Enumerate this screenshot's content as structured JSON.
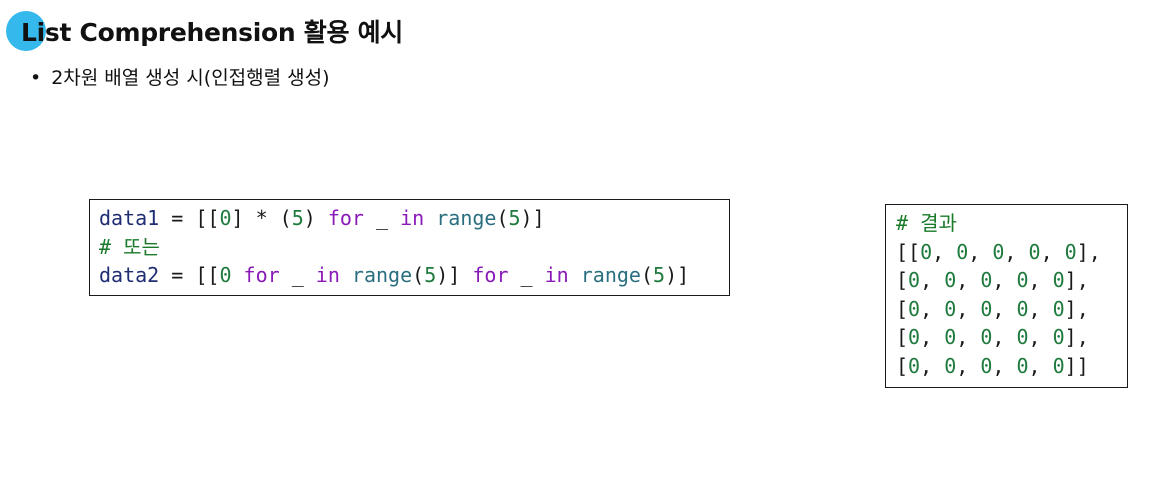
{
  "slide": {
    "title": "List Comprehension 활용 예시",
    "bullet": "•",
    "subtitle": "2차원 배열 생성 시(인접행렬 생성)"
  },
  "code_left": {
    "line1": {
      "var": "data1",
      "p1": " = [[",
      "n1": "0",
      "p2": "] * (",
      "n2": "5",
      "p3": ") ",
      "kw1": "for",
      "p4": " _ ",
      "kw2": "in",
      "p5": " ",
      "fn": "range",
      "p6": "(",
      "n3": "5",
      "p7": ")]"
    },
    "line2": "# 또는",
    "line3": {
      "var": "data2",
      "p1": " = [[",
      "n1": "0",
      "p2": " ",
      "kw1": "for",
      "p3": " _ ",
      "kw2": "in",
      "p4": " ",
      "fn1": "range",
      "p5": "(",
      "n2": "5",
      "p6": ")] ",
      "kw3": "for",
      "p7": " _ ",
      "kw4": "in",
      "p8": " ",
      "fn2": "range",
      "p9": "(",
      "n3": "5",
      "p10": ")]"
    }
  },
  "code_right": {
    "comment": "# 결과",
    "rows": [
      {
        "open": "[[",
        "close": "],"
      },
      {
        "open": "[",
        "close": "],"
      },
      {
        "open": "[",
        "close": "],"
      },
      {
        "open": "[",
        "close": "],"
      },
      {
        "open": "[",
        "close": "]]"
      }
    ],
    "zero": "0",
    "sep": ", "
  },
  "colors": {
    "accent_dot": "#35b9ec",
    "keyword": "#8a1ab8",
    "builtin": "#2a6f7f",
    "number": "#1f7a3d",
    "variable": "#1f2d73",
    "comment": "#1a7a2a"
  }
}
